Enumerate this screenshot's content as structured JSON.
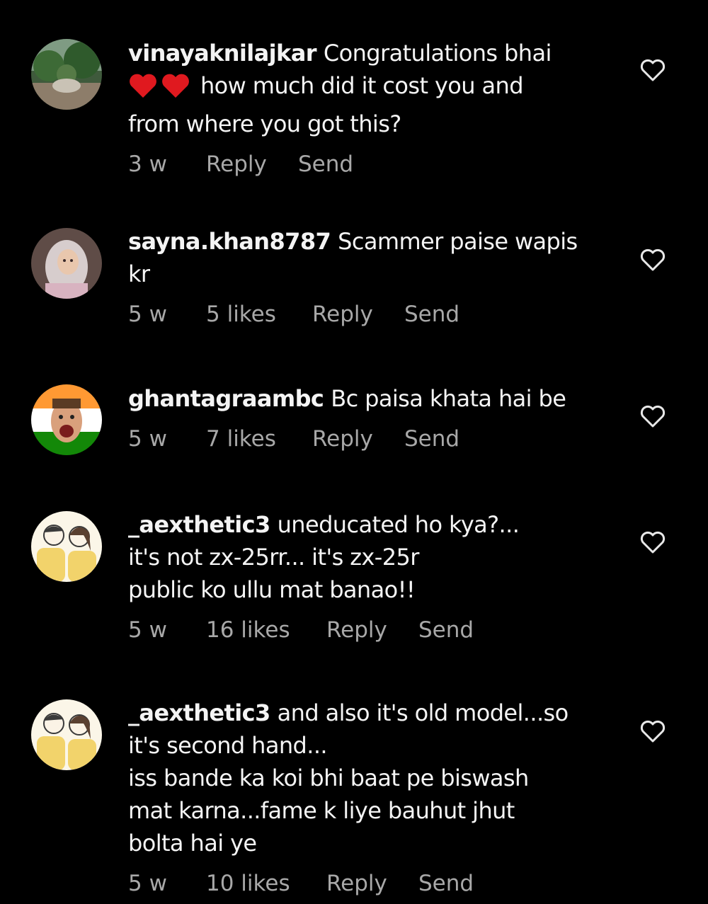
{
  "colors": {
    "background": "#000000",
    "text": "#f4f4f4",
    "meta": "#a8a8a8",
    "heart_emoji": "#e0191f"
  },
  "comments": [
    {
      "username": "vinayaknilajkar",
      "lines": [
        "Congratulations bhai",
        "how much did it cost you and",
        "from where you got this?"
      ],
      "emoji": "red-heart-emoji x2",
      "time": "3 w",
      "likes": "",
      "reply": "Reply",
      "send": "Send",
      "avatar": "avatar-garden-photo",
      "like_icon": "heart-outline-icon"
    },
    {
      "username": "sayna.khan8787",
      "lines": [
        "Scammer paise wapis",
        "kr"
      ],
      "time": "5 w",
      "likes": "5 likes",
      "reply": "Reply",
      "send": "Send",
      "avatar": "avatar-hijab-girl-illustration",
      "like_icon": "heart-outline-icon"
    },
    {
      "username": "ghantagraambc",
      "lines": [
        "Bc paisa khata hai be"
      ],
      "time": "5 w",
      "likes": "7 likes",
      "reply": "Reply",
      "send": "Send",
      "avatar": "avatar-laughing-face-tricolor",
      "like_icon": "heart-outline-icon"
    },
    {
      "username": "_aexthetic3",
      "lines": [
        "uneducated ho kya?...",
        "it's not zx-25rr... it's zx-25r",
        "public ko ullu mat banao!!"
      ],
      "time": "5 w",
      "likes": "16 likes",
      "reply": "Reply",
      "send": "Send",
      "avatar": "avatar-couple-illustration",
      "like_icon": "heart-outline-icon"
    },
    {
      "username": "_aexthetic3",
      "lines": [
        "and also it's old model...so",
        "it's second hand...",
        "iss bande ka koi bhi baat pe biswash",
        "mat karna...fame k liye bauhut jhut",
        "bolta hai ye"
      ],
      "time": "5 w",
      "likes": "10 likes",
      "reply": "Reply",
      "send": "Send",
      "avatar": "avatar-couple-illustration",
      "like_icon": "heart-outline-icon"
    }
  ]
}
